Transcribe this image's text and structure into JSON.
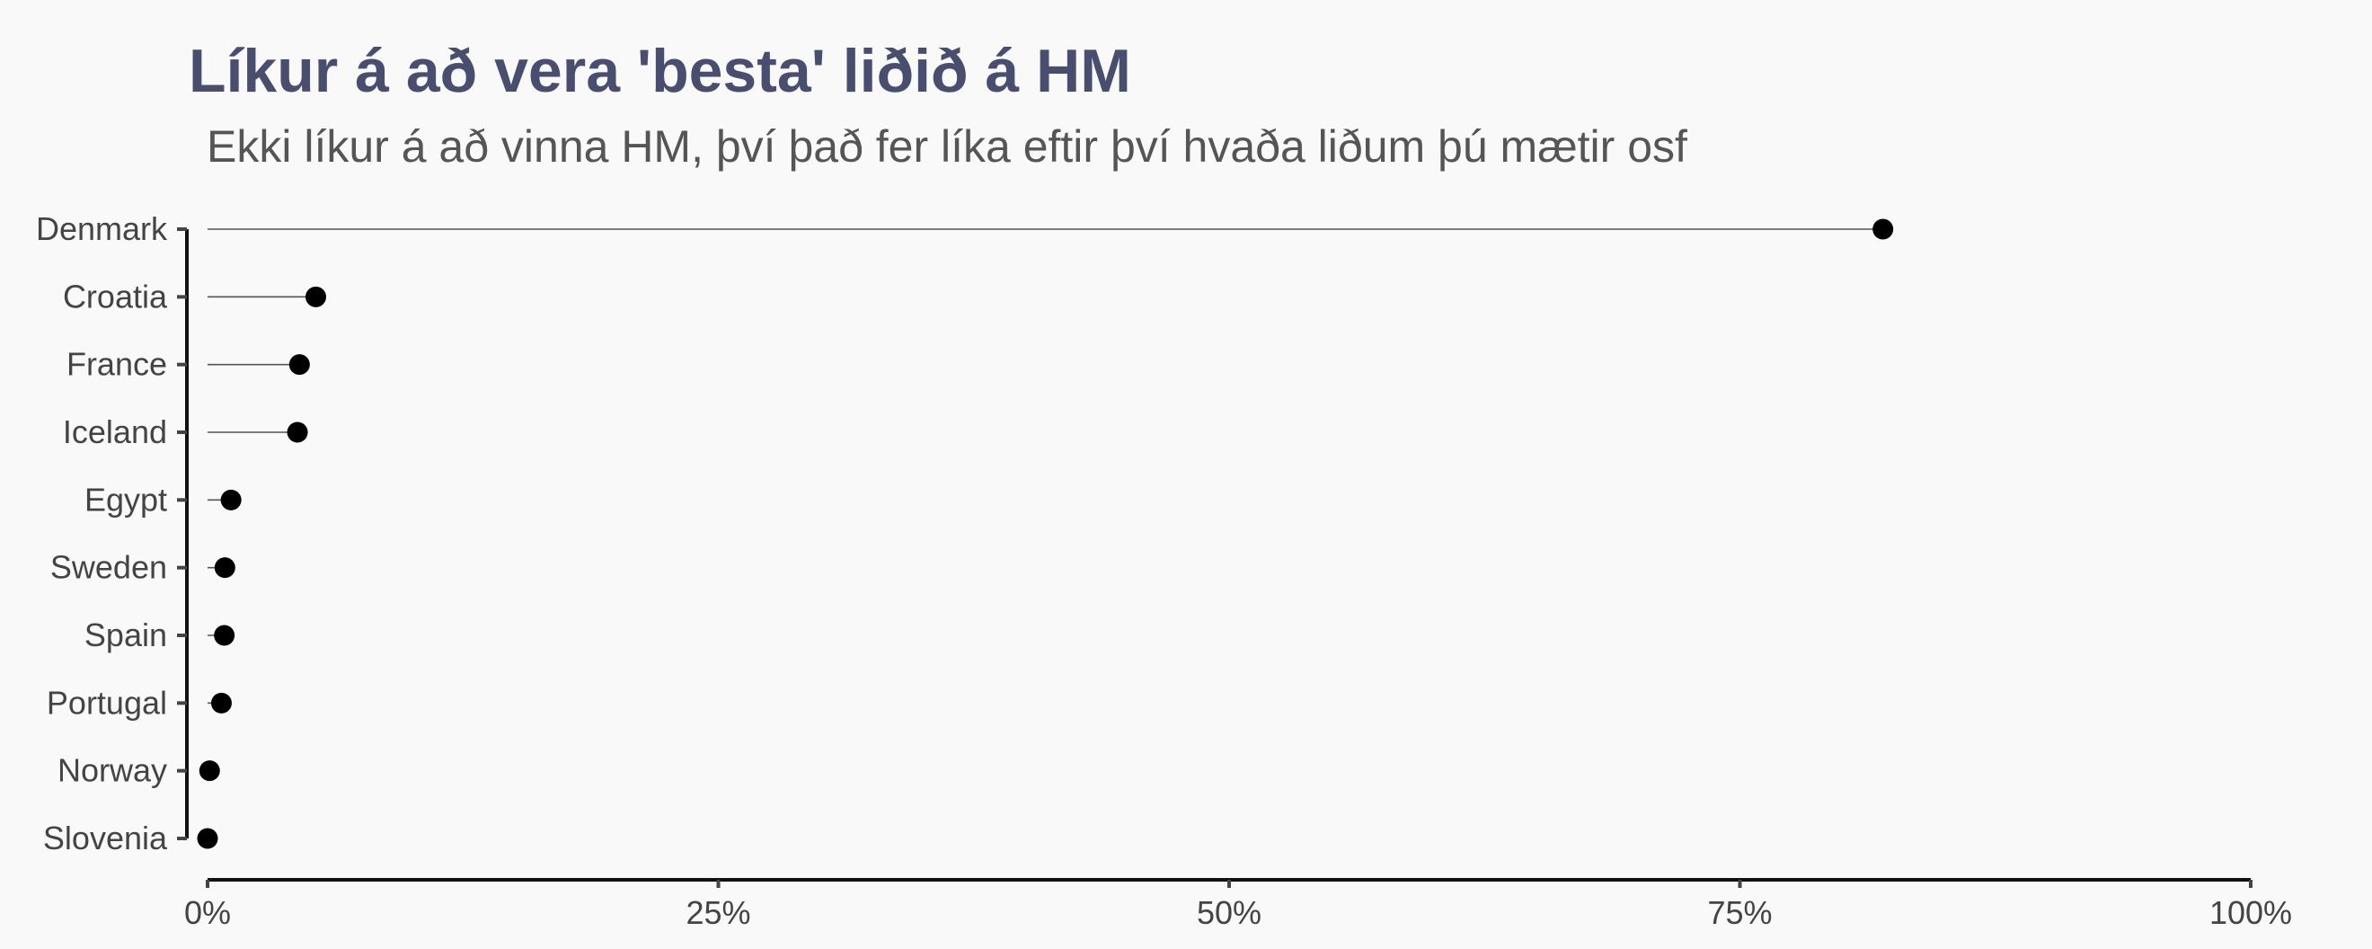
{
  "chart_data": {
    "type": "lollipop",
    "title": "Líkur á að vera 'besta' liðið á HM",
    "subtitle": "Ekki líkur á að vinna HM, því það fer líka eftir því hvaða liðum þú mætir osf",
    "xlabel": "",
    "ylabel": "",
    "xlim": [
      0,
      1
    ],
    "x_ticks": [
      0,
      0.25,
      0.5,
      0.75,
      1
    ],
    "x_tick_labels": [
      "0%",
      "25%",
      "50%",
      "75%",
      "100%"
    ],
    "categories": [
      "Denmark",
      "Croatia",
      "France",
      "Iceland",
      "Egypt",
      "Sweden",
      "Spain",
      "Portugal",
      "Norway",
      "Slovenia"
    ],
    "values": [
      0.82,
      0.053,
      0.045,
      0.044,
      0.0115,
      0.0085,
      0.0082,
      0.0068,
      0.001,
      0.0
    ],
    "grid": false,
    "colors": {
      "background": "#f9f9f9",
      "title": "#4a4e6e",
      "point": "#000000",
      "segment": "#555555"
    }
  }
}
